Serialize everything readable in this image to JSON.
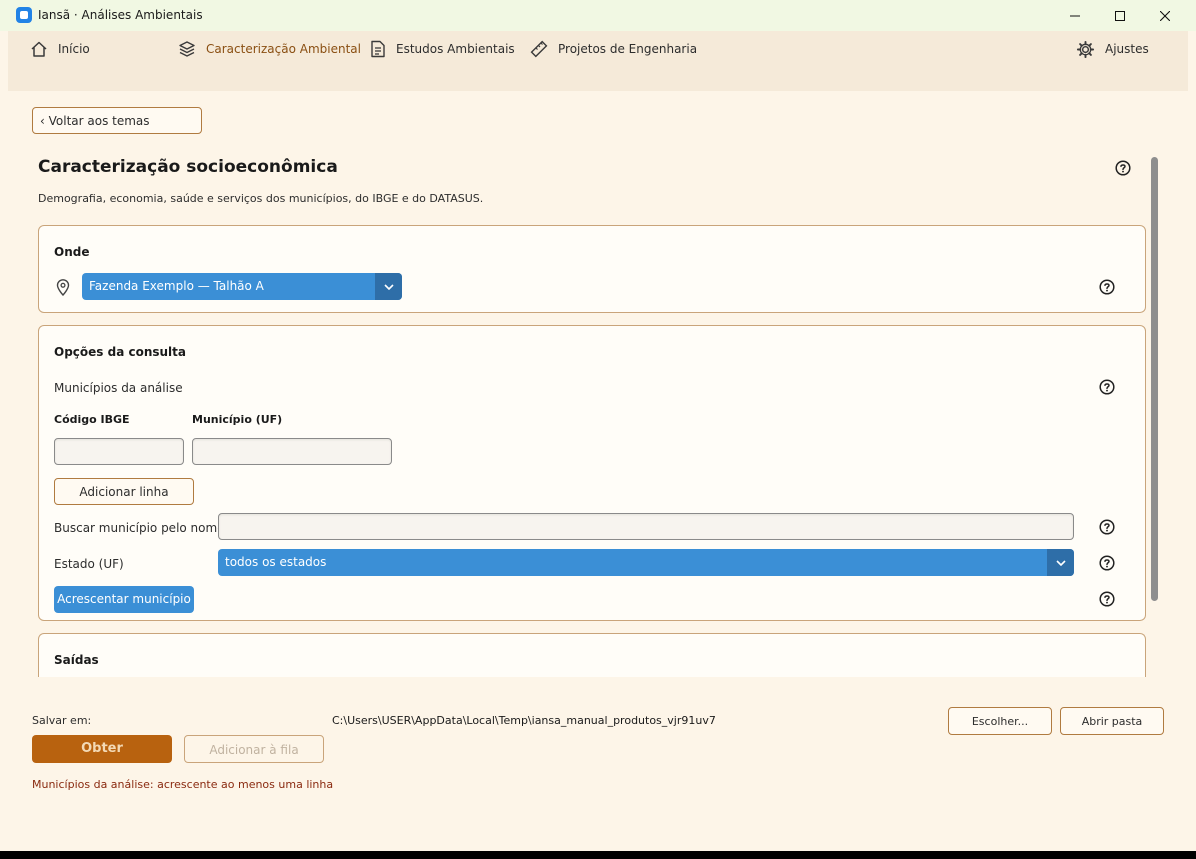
{
  "window": {
    "title": "Iansã · Análises Ambientais"
  },
  "nav": {
    "home": "Início",
    "caracterizacao": "Caracterização Ambiental",
    "estudos": "Estudos Ambientais",
    "projetos": "Projetos de Engenharia",
    "ajustes": "Ajustes"
  },
  "page": {
    "back_label": "‹ Voltar aos temas",
    "title": "Caracterização socioeconômica",
    "subtitle": "Demografia, economia, saúde e serviços dos municípios, do IBGE e do DATASUS."
  },
  "onde": {
    "title": "Onde",
    "selected": "Fazenda Exemplo — Talhão A"
  },
  "opcoes": {
    "title": "Opções da consulta",
    "municipios_label": "Municípios da análise",
    "col_codigo": "Código IBGE",
    "col_municipio": "Município (UF)",
    "codigo_value": "",
    "municipio_value": "",
    "add_row": "Adicionar linha",
    "buscar_label": "Buscar município pelo nome",
    "buscar_value": "",
    "estado_label": "Estado (UF)",
    "estado_selected": "todos os estados",
    "acrescentar": "Acrescentar município"
  },
  "saidas": {
    "title": "Saídas"
  },
  "footer": {
    "salvar_label": "Salvar em:",
    "path": "C:\\Users\\USER\\AppData\\Local\\Temp\\iansa_manual_produtos_vjr91uv7",
    "escolher": "Escolher...",
    "abrir_pasta": "Abrir pasta",
    "obter": "Obter",
    "adicionar_fila": "Adicionar à fila",
    "error": "Municípios da análise: acrescente ao menos uma linha"
  },
  "colors": {
    "accent_blue": "#3b8fd6",
    "primary_brown": "#b8620f",
    "border_tan": "#c9a47a",
    "background": "#fdf5e8",
    "error": "#8a2a10"
  }
}
